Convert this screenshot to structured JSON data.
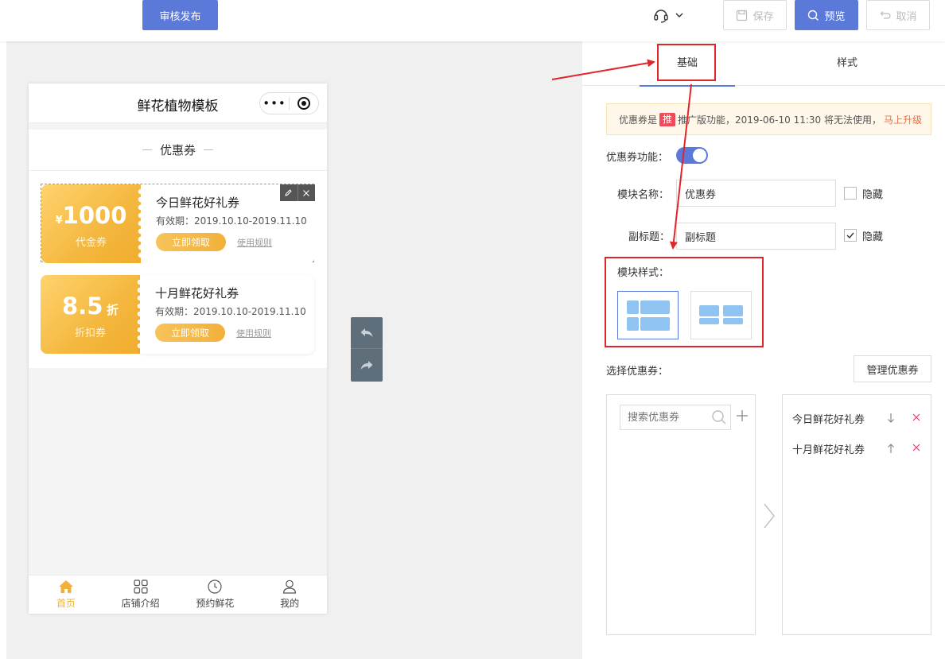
{
  "toolbar": {
    "publish_label": "审核发布",
    "save_label": "保存",
    "preview_label": "预览",
    "cancel_label": "取消"
  },
  "phone": {
    "title": "鲜花植物模板",
    "capsule_dots": "•••",
    "module_title": "优惠券",
    "coupons": [
      {
        "currency": "¥",
        "amount": "1000",
        "suffix": "",
        "type": "代金券",
        "name": "今日鲜花好礼券",
        "validity": "有效期：2019.10.10-2019.11.10",
        "claim": "立即领取",
        "rules": "使用规则"
      },
      {
        "currency": "",
        "amount": "8.5",
        "suffix": "折",
        "type": "折扣券",
        "name": "十月鲜花好礼券",
        "validity": "有效期：2019.10.10-2019.11.10",
        "claim": "立即领取",
        "rules": "使用规则"
      }
    ],
    "tabbar": [
      {
        "label": "首页",
        "icon": "home-icon"
      },
      {
        "label": "店铺介绍",
        "icon": "grid-icon"
      },
      {
        "label": "预约鲜花",
        "icon": "clock-icon"
      },
      {
        "label": "我的",
        "icon": "user-icon"
      }
    ]
  },
  "panel": {
    "tabs": {
      "basic": "基础",
      "style": "样式"
    },
    "notice": {
      "prefix": "优惠券是",
      "badge": "推",
      "text": "推广版功能，2019-06-10 11:30 将无法使用，",
      "upgrade": "马上升级"
    },
    "coupon_function_label": "优惠券功能：",
    "module_name_label": "模块名称：",
    "module_name_value": "优惠券",
    "subtitle_label": "副标题：",
    "subtitle_value": "副标题",
    "hide_label": "隐藏",
    "module_style_label": "模块样式：",
    "select_coupon_label": "选择优惠券：",
    "manage_button": "管理优惠券",
    "search_placeholder": "搜索优惠券",
    "selected": [
      "今日鲜花好礼券",
      "十月鲜花好礼券"
    ]
  },
  "colors": {
    "accent": "#5b79d9",
    "coupon": "#f2b03a",
    "annotation": "#e0252b"
  }
}
